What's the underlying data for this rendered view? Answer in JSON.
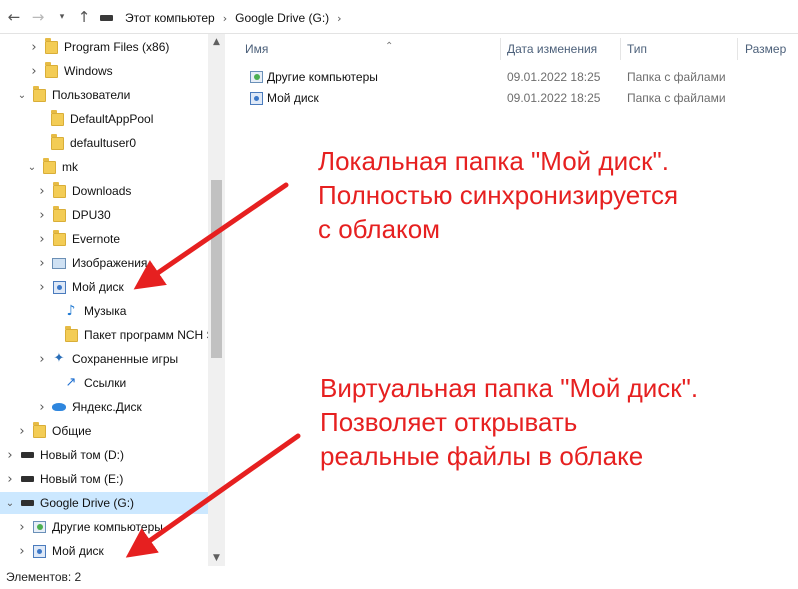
{
  "address_bar": {
    "back_icon": "arrow-left",
    "forward_icon": "arrow-right",
    "recent_icon": "chevron-down",
    "up_icon": "arrow-up",
    "crumbs": [
      "Этот компьютер",
      "Google Drive (G:)"
    ]
  },
  "tree": {
    "items": [
      {
        "label": "Program Files (x86)",
        "icon": "folder",
        "expander": "collapsed"
      },
      {
        "label": "Windows",
        "icon": "folder",
        "expander": "collapsed"
      },
      {
        "label": "Пользователи",
        "icon": "folder",
        "expander": "expanded"
      },
      {
        "label": "DefaultAppPool",
        "icon": "folder",
        "expander": "none"
      },
      {
        "label": "defaultuser0",
        "icon": "folder",
        "expander": "none"
      },
      {
        "label": "mk",
        "icon": "folder",
        "expander": "expanded"
      },
      {
        "label": "Downloads",
        "icon": "folder",
        "expander": "collapsed"
      },
      {
        "label": "DPU30",
        "icon": "folder",
        "expander": "collapsed"
      },
      {
        "label": "Evernote",
        "icon": "folder",
        "expander": "collapsed"
      },
      {
        "label": "Изображения",
        "icon": "pictures",
        "expander": "collapsed"
      },
      {
        "label": "Мой диск",
        "icon": "google-drive-folder",
        "expander": "collapsed"
      },
      {
        "label": "Музыка",
        "icon": "music",
        "expander": "none"
      },
      {
        "label": "Пакет программ NCH S",
        "icon": "folder",
        "expander": "none"
      },
      {
        "label": "Сохраненные игры",
        "icon": "saved-games",
        "expander": "collapsed"
      },
      {
        "label": "Ссылки",
        "icon": "links",
        "expander": "none"
      },
      {
        "label": "Яндекс.Диск",
        "icon": "yandex-disk",
        "expander": "collapsed"
      },
      {
        "label": "Общие",
        "icon": "folder",
        "expander": "collapsed"
      },
      {
        "label": "Новый том (D:)",
        "icon": "drive",
        "expander": "collapsed"
      },
      {
        "label": "Новый том (E:)",
        "icon": "drive",
        "expander": "collapsed"
      },
      {
        "label": "Google Drive (G:)",
        "icon": "drive",
        "expander": "expanded",
        "selected": true
      },
      {
        "label": "Другие компьютеры",
        "icon": "other-computers",
        "expander": "collapsed"
      },
      {
        "label": "Мой диск",
        "icon": "google-drive-folder",
        "expander": "collapsed"
      }
    ]
  },
  "list": {
    "columns": [
      "Имя",
      "Дата изменения",
      "Тип",
      "Размер"
    ],
    "rows": [
      {
        "name": "Другие компьютеры",
        "date": "09.01.2022 18:25",
        "type": "Папка с файлами",
        "icon": "other-computers"
      },
      {
        "name": "Мой диск",
        "date": "09.01.2022 18:25",
        "type": "Папка с файлами",
        "icon": "google-drive-folder"
      }
    ]
  },
  "status": {
    "text": "Элементов: 2"
  },
  "annotations": {
    "top": [
      "Локальная папка \"Мой диск\".",
      "Полностью синхронизируется",
      "с облаком"
    ],
    "bottom": [
      "Виртуальная папка \"Мой диск\".",
      "Позволяет открывать",
      "реальные файлы в облаке"
    ]
  },
  "colors": {
    "annotation": "#e62020",
    "selection": "#cce8ff"
  }
}
